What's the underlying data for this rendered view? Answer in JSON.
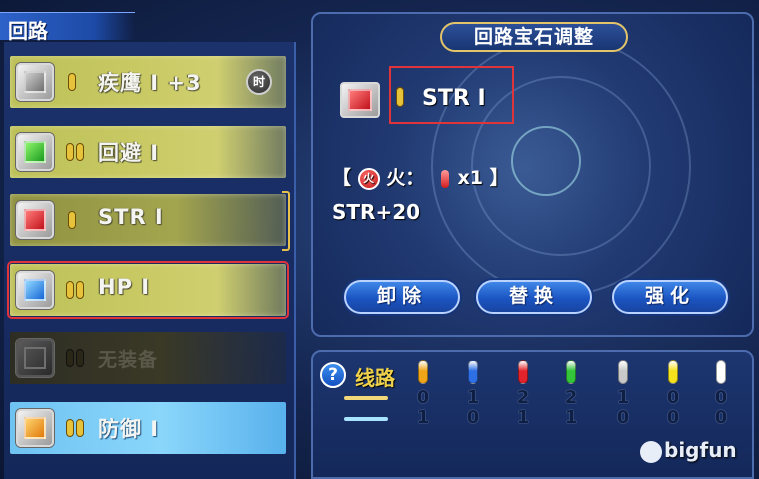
{
  "left_panel": {
    "title": "回路",
    "rows": [
      {
        "label": "疾鹰 Ⅰ +3",
        "gem": "grey",
        "slots": 1,
        "badge": "时",
        "style": "gold"
      },
      {
        "label": "回避 Ⅰ",
        "gem": "green",
        "slots": 2,
        "badge": "",
        "style": "gold"
      },
      {
        "label": "STR Ⅰ",
        "gem": "red",
        "slots": 1,
        "badge": "",
        "style": "gold-dark"
      },
      {
        "label": "HP Ⅰ",
        "gem": "blue",
        "slots": 2,
        "badge": "",
        "style": "gold",
        "selected": true
      },
      {
        "label": "无装备",
        "gem": "empty",
        "slots": 2,
        "badge": "",
        "style": "empty"
      },
      {
        "label": "防御 Ⅰ",
        "gem": "orange",
        "slots": 2,
        "badge": "",
        "style": "blue"
      }
    ]
  },
  "adjust_panel": {
    "title": "回路宝石调整",
    "selected_gem_name": "STR Ⅰ",
    "effect": {
      "bracket_open": "【",
      "element_icon": "火",
      "element_label": "火：",
      "multiplier": "x1",
      "bracket_close": "】"
    },
    "bonus": "STR+20",
    "buttons": [
      "卸除",
      "替换",
      "强化"
    ]
  },
  "circuit_panel": {
    "help": "?",
    "title": "线路",
    "line_colors": [
      "#f2d77a",
      "#a8e3ff"
    ],
    "gem_columns": [
      {
        "color": "#f0a518",
        "row1": "0",
        "row2": "1"
      },
      {
        "color": "#2d6fe6",
        "row1": "1",
        "row2": "0"
      },
      {
        "color": "#e3232b",
        "row1": "2",
        "row2": "1"
      },
      {
        "color": "#33c43a",
        "row1": "2",
        "row2": "1"
      },
      {
        "color": "#c9c9c9",
        "row1": "1",
        "row2": "0"
      },
      {
        "color": "#f4e21c",
        "row1": "0",
        "row2": "0"
      },
      {
        "color": "#ffffff",
        "row1": "0",
        "row2": "0"
      }
    ]
  },
  "watermark": "bigfun"
}
